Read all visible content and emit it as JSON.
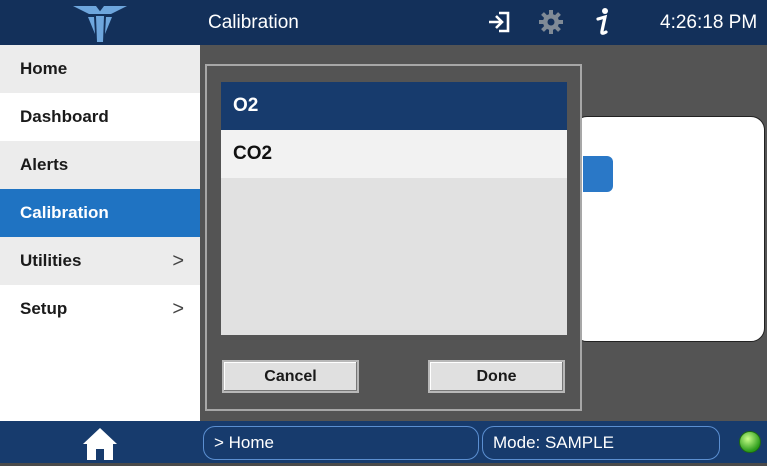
{
  "header": {
    "title": "Calibration",
    "time": "4:26:18 PM",
    "logo": "teledyne-logo",
    "icons": [
      "exit-icon",
      "gear-icon",
      "info-icon"
    ]
  },
  "sidebar": {
    "items": [
      {
        "label": "Home",
        "has_submenu": false
      },
      {
        "label": "Dashboard",
        "has_submenu": false
      },
      {
        "label": "Alerts",
        "has_submenu": false
      },
      {
        "label": "Calibration",
        "has_submenu": false,
        "active": true
      },
      {
        "label": "Utilities",
        "has_submenu": true,
        "chevron": ">"
      },
      {
        "label": "Setup",
        "has_submenu": true,
        "chevron": ">"
      }
    ]
  },
  "dialog": {
    "options": [
      {
        "label": "O2",
        "selected": true
      },
      {
        "label": "CO2",
        "selected": false
      }
    ],
    "cancel_label": "Cancel",
    "done_label": "Done"
  },
  "footer": {
    "breadcrumb": "> Home",
    "mode": "Mode: SAMPLE",
    "status_icon": "status-led-green"
  },
  "colors": {
    "header": "#13305a",
    "accent": "#1f73c2",
    "selected": "#173b6d"
  }
}
